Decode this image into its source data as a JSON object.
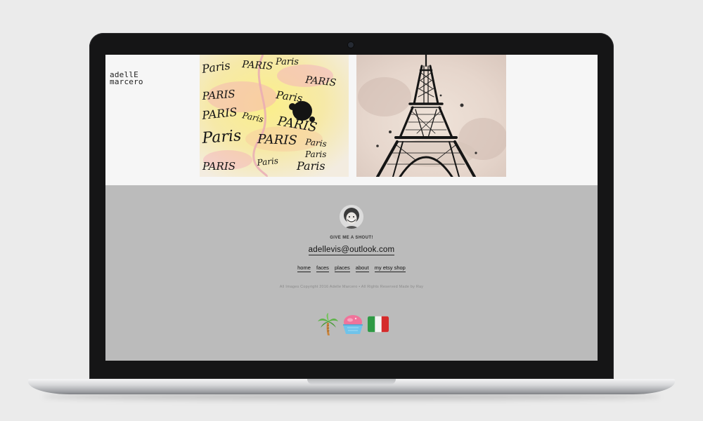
{
  "site": {
    "logo_line1": "adellE",
    "logo_line2": "marcero"
  },
  "gallery": [
    {
      "name": "paris-lettering-artwork",
      "words": [
        "Paris",
        "PARIS",
        "Paris",
        "PARIS",
        "PARIS",
        "Paris",
        "PARIS",
        "PARIS",
        "Paris",
        "PARIS",
        "Paris",
        "Paris",
        "PARIS",
        "Paris",
        "Paris",
        "Paris"
      ]
    },
    {
      "name": "eiffel-tower-artwork"
    }
  ],
  "footer": {
    "shout": "GIVE ME A SHOUT!",
    "email": "adellevis@outlook.com",
    "nav": [
      "home",
      "faces",
      "places",
      "about",
      "my etsy shop"
    ],
    "copyright": "All Images Copyright 2016 Adelle Marcero • All Rights Reserved Made by Ray",
    "emojis": [
      "palm-tree-icon",
      "shaved-ice-icon",
      "italy-flag-icon"
    ]
  },
  "colors": {
    "page_background": "#ebebeb",
    "screen_header": "#f6f6f6",
    "footer_background": "#bbbbbb",
    "bezel": "#151516"
  }
}
